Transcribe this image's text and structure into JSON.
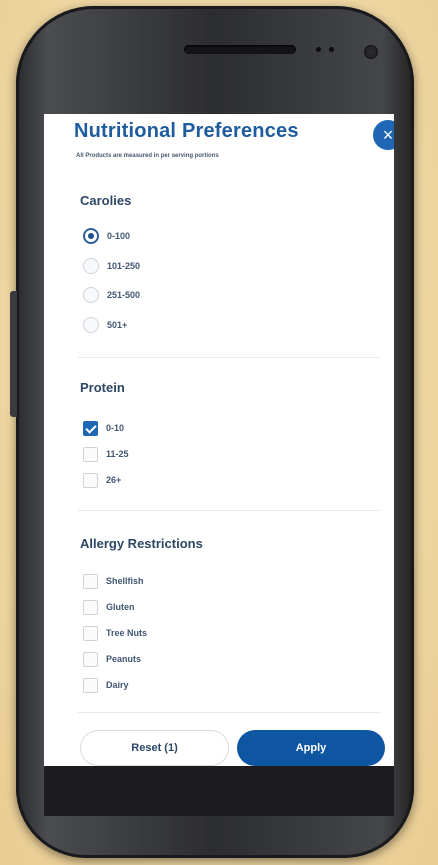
{
  "header": {
    "title": "Nutritional Preferences",
    "subtitle": "All Products are measured in per serving portions",
    "close_icon": "×"
  },
  "calories": {
    "title": "Carolies",
    "options": [
      {
        "label": "0-100",
        "selected": true
      },
      {
        "label": "101-250",
        "selected": false
      },
      {
        "label": "251-500",
        "selected": false
      },
      {
        "label": "501+",
        "selected": false
      }
    ]
  },
  "protein": {
    "title": "Protein",
    "options": [
      {
        "label": "0-10",
        "checked": true
      },
      {
        "label": "11-25",
        "checked": false
      },
      {
        "label": "26+",
        "checked": false
      }
    ]
  },
  "allergy": {
    "title": "Allergy Restrictions",
    "options": [
      {
        "label": "Shellfish",
        "checked": false
      },
      {
        "label": "Gluten",
        "checked": false
      },
      {
        "label": "Tree Nuts",
        "checked": false
      },
      {
        "label": "Peanuts",
        "checked": false
      },
      {
        "label": "Dairy",
        "checked": false
      }
    ]
  },
  "footer": {
    "reset_label": "Reset (1)",
    "apply_label": "Apply"
  },
  "colors": {
    "accent": "#1f66b5",
    "title": "#1f5c9e",
    "apply": "#0f56a2"
  }
}
